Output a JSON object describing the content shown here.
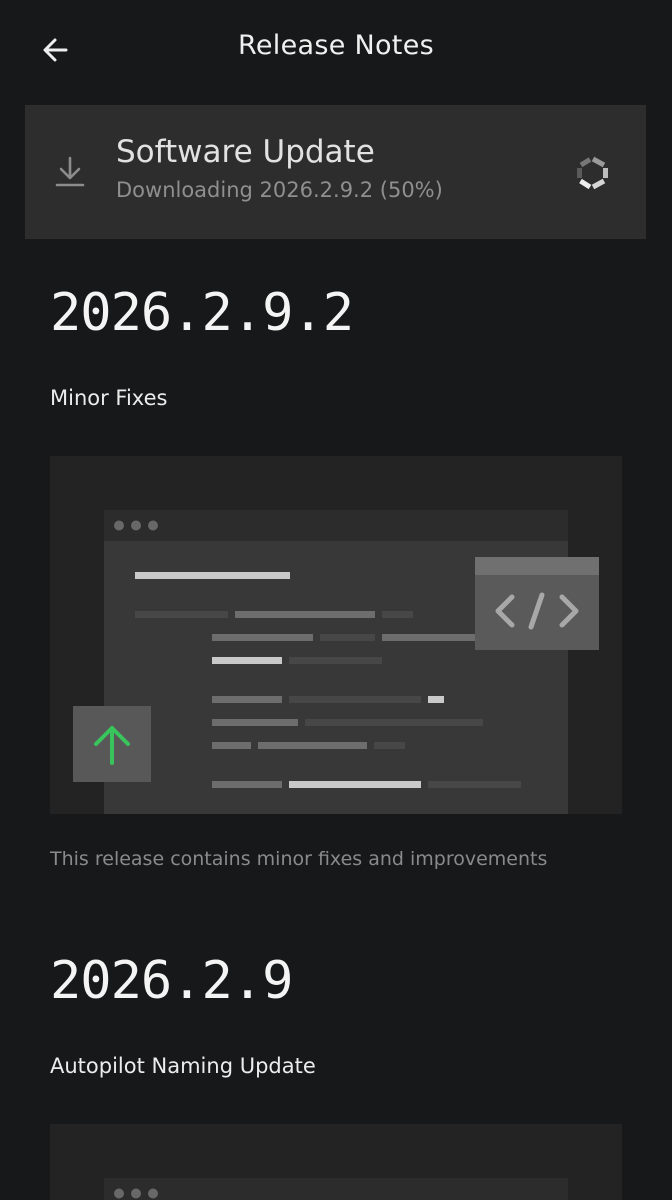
{
  "header": {
    "title": "Release Notes",
    "back_icon": "arrow-left-icon"
  },
  "update_card": {
    "icon": "download-icon",
    "title": "Software Update",
    "status": "Downloading 2026.2.9.2 (50%)",
    "progress_percent": 50,
    "spinner_icon": "progress-ring-icon"
  },
  "releases": [
    {
      "version": "2026.2.9.2",
      "subtitle": "Minor Fixes",
      "illustration_icons": [
        "code-icon",
        "arrow-up-icon"
      ],
      "description": "This release contains minor fixes and improvements"
    },
    {
      "version": "2026.2.9",
      "subtitle": "Autopilot Naming Update"
    }
  ],
  "colors": {
    "background": "#161819",
    "card": "#2d2d2d",
    "accent_green": "#39c45c"
  }
}
